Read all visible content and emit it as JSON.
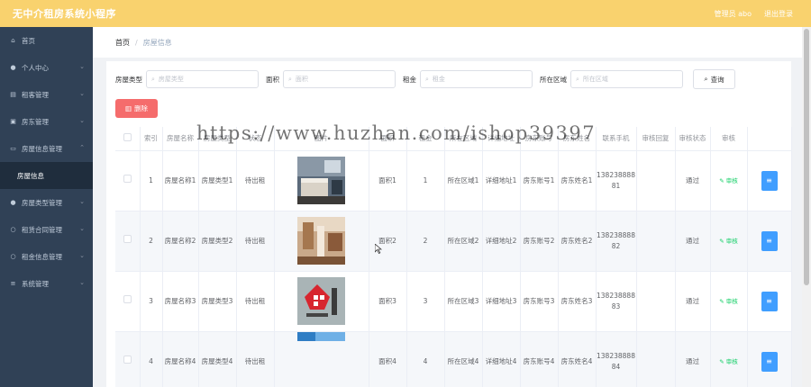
{
  "app": {
    "title": "无中介租房系统小程序",
    "user": "管理员 abo",
    "logout": "退出登录"
  },
  "sidebar": {
    "items": [
      {
        "label": "首页",
        "icon": "home-icon",
        "chevron": false
      },
      {
        "label": "个人中心",
        "icon": "user-icon",
        "chevron": true
      },
      {
        "label": "租客管理",
        "icon": "list-icon",
        "chevron": true
      },
      {
        "label": "房东管理",
        "icon": "card-icon",
        "chevron": true
      },
      {
        "label": "房屋信息管理",
        "icon": "message-icon",
        "chevron": true
      },
      {
        "label": "房屋信息",
        "icon": "",
        "chevron": false,
        "sub": true
      },
      {
        "label": "房屋类型管理",
        "icon": "user-icon",
        "chevron": true
      },
      {
        "label": "租赁合同管理",
        "icon": "info-icon",
        "chevron": true
      },
      {
        "label": "租金信息管理",
        "icon": "info-icon",
        "chevron": true
      },
      {
        "label": "系统管理",
        "icon": "menu-icon",
        "chevron": true
      }
    ]
  },
  "breadcrumb": {
    "home": "首页",
    "current": "房屋信息"
  },
  "search": {
    "fields": [
      {
        "label": "房屋类型",
        "placeholder": "房屋类型"
      },
      {
        "label": "面积",
        "placeholder": "面积"
      },
      {
        "label": "租金",
        "placeholder": "租金"
      },
      {
        "label": "所在区域",
        "placeholder": "所在区域"
      }
    ],
    "query_label": "查询",
    "delete_label": "删除"
  },
  "table": {
    "headers": [
      "",
      "索引",
      "房屋名称",
      "房屋类型",
      "状态",
      "图片",
      "面积",
      "租金",
      "所在区域",
      "详细地址",
      "房东账号",
      "房东姓名",
      "联系手机",
      "审核回复",
      "审核状态",
      "审核",
      ""
    ],
    "audit_label": "审核",
    "rows": [
      {
        "index": "1",
        "name": "房屋名称1",
        "type": "房屋类型1",
        "status": "待出租",
        "area": "面积1",
        "rent": "1",
        "region": "所在区域1",
        "address": "详细地址1",
        "account": "房东账号1",
        "owner": "房东姓名1",
        "phone": "13823888881",
        "reply": "",
        "audit_status": "通过"
      },
      {
        "index": "2",
        "name": "房屋名称2",
        "type": "房屋类型2",
        "status": "待出租",
        "area": "面积2",
        "rent": "2",
        "region": "所在区域2",
        "address": "详细地址2",
        "account": "房东账号2",
        "owner": "房东姓名2",
        "phone": "13823888882",
        "reply": "",
        "audit_status": "通过"
      },
      {
        "index": "3",
        "name": "房屋名称3",
        "type": "房屋类型3",
        "status": "待出租",
        "area": "面积3",
        "rent": "3",
        "region": "所在区域3",
        "address": "详细地址3",
        "account": "房东账号3",
        "owner": "房东姓名3",
        "phone": "13823888883",
        "reply": "",
        "audit_status": "通过"
      },
      {
        "index": "4",
        "name": "房屋名称4",
        "type": "房屋类型4",
        "status": "待出租",
        "area": "面积4",
        "rent": "4",
        "region": "所在区域4",
        "address": "详细地址4",
        "account": "房东账号4",
        "owner": "房东姓名4",
        "phone": "13823888884",
        "reply": "",
        "audit_status": "通过"
      }
    ]
  },
  "watermark": "https://www.huzhan.com/ishop39397",
  "colors": {
    "topbar": "#f9d26e",
    "sidebar": "#304156",
    "danger": "#f56c6c",
    "primary": "#409eff",
    "success": "#13ce66"
  }
}
